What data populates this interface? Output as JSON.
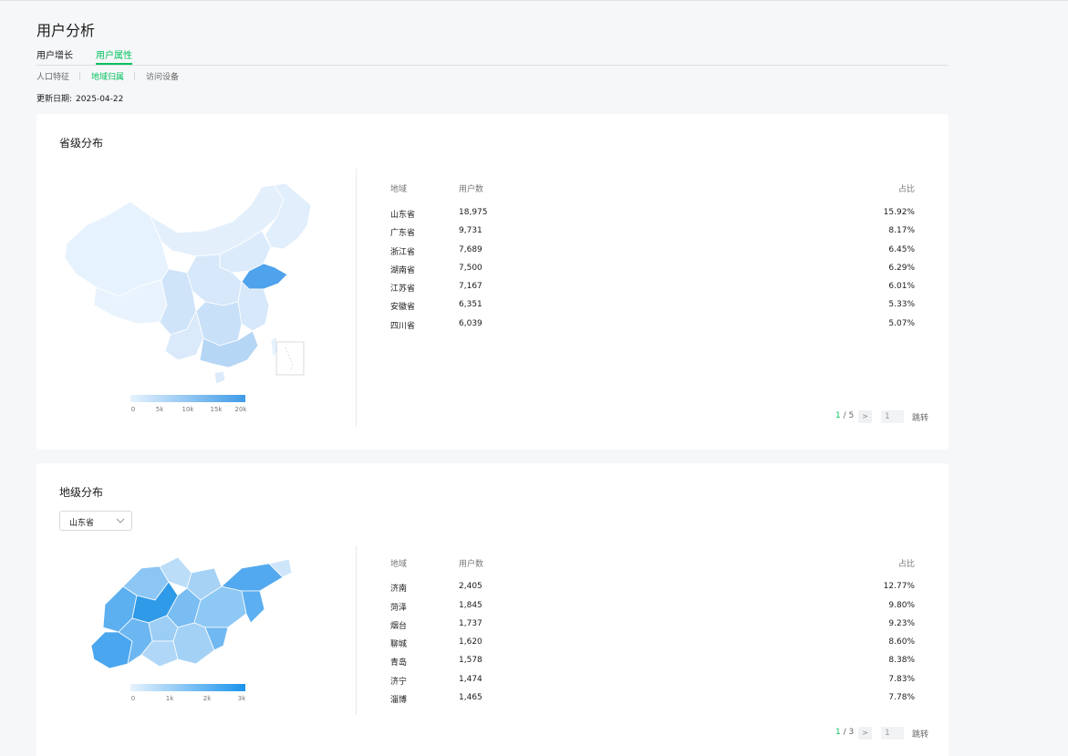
{
  "page": {
    "title": "用户分析"
  },
  "tabs": [
    {
      "label": "用户增长"
    },
    {
      "label": "用户属性"
    }
  ],
  "subtabs": [
    {
      "label": "人口特征"
    },
    {
      "label": "地域归属"
    },
    {
      "label": "访问设备"
    }
  ],
  "update": {
    "label": "更新日期:",
    "date": "2025-04-22"
  },
  "colors": {
    "accent": "#07c160",
    "map_light": "#e6f2fd",
    "map_dark": "#3f9be8"
  },
  "province": {
    "title": "省级分布",
    "headers": {
      "region": "地域",
      "users": "用户数",
      "ratio": "占比"
    },
    "rows": [
      {
        "region": "山东省",
        "users": "18,975",
        "ratio": "15.92%"
      },
      {
        "region": "广东省",
        "users": "9,731",
        "ratio": "8.17%"
      },
      {
        "region": "浙江省",
        "users": "7,689",
        "ratio": "6.45%"
      },
      {
        "region": "湖南省",
        "users": "7,500",
        "ratio": "6.29%"
      },
      {
        "region": "江苏省",
        "users": "7,167",
        "ratio": "6.01%"
      },
      {
        "region": "安徽省",
        "users": "6,351",
        "ratio": "5.33%"
      },
      {
        "region": "四川省",
        "users": "6,039",
        "ratio": "5.07%"
      }
    ],
    "legend_ticks": [
      "0",
      "5k",
      "10k",
      "15k",
      "20k"
    ],
    "pager": {
      "current": "1",
      "total": "5",
      "input_value": "1",
      "go_label": "跳转",
      "next_icon": "chevron-right-icon"
    }
  },
  "city": {
    "title": "地级分布",
    "select": {
      "value": "山东省",
      "icon": "chevron-down-icon"
    },
    "headers": {
      "region": "地域",
      "users": "用户数",
      "ratio": "占比"
    },
    "rows": [
      {
        "region": "济南",
        "users": "2,405",
        "ratio": "12.77%"
      },
      {
        "region": "菏泽",
        "users": "1,845",
        "ratio": "9.80%"
      },
      {
        "region": "烟台",
        "users": "1,737",
        "ratio": "9.23%"
      },
      {
        "region": "聊城",
        "users": "1,620",
        "ratio": "8.60%"
      },
      {
        "region": "青岛",
        "users": "1,578",
        "ratio": "8.38%"
      },
      {
        "region": "济宁",
        "users": "1,474",
        "ratio": "7.83%"
      },
      {
        "region": "淄博",
        "users": "1,465",
        "ratio": "7.78%"
      }
    ],
    "legend_ticks": [
      "0",
      "1k",
      "2k",
      "3k"
    ],
    "pager": {
      "current": "1",
      "total": "3",
      "input_value": "1",
      "go_label": "跳转",
      "next_icon": "chevron-right-icon"
    }
  }
}
